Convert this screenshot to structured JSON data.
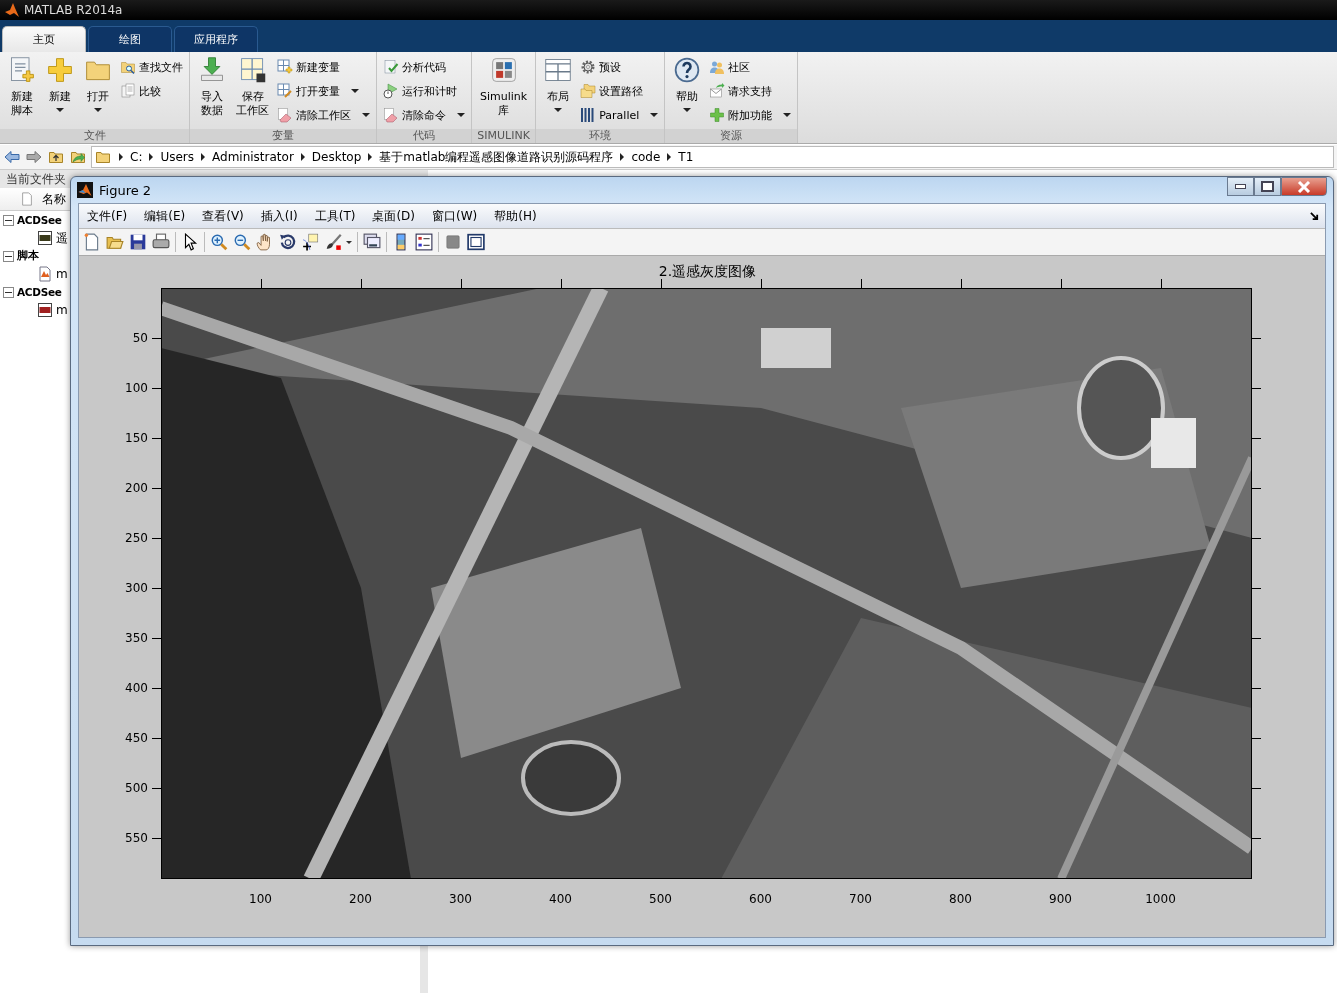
{
  "window": {
    "title": "MATLAB R2014a"
  },
  "tabs": [
    {
      "label": "主页",
      "selected": true
    },
    {
      "label": "绘图",
      "selected": false
    },
    {
      "label": "应用程序",
      "selected": false
    }
  ],
  "ribbon": [
    {
      "label": "文件",
      "large": [
        {
          "lines": [
            "新建",
            "脚本"
          ],
          "dropdown": false
        },
        {
          "lines": [
            "新建"
          ],
          "dropdown": true
        },
        {
          "lines": [
            "打开"
          ],
          "dropdown": true
        }
      ],
      "small": [
        {
          "label": "查找文件",
          "dropdown": false
        },
        {
          "label": "比较",
          "dropdown": false
        }
      ]
    },
    {
      "label": "变量",
      "large": [
        {
          "lines": [
            "导入",
            "数据"
          ],
          "dropdown": false
        },
        {
          "lines": [
            "保存",
            "工作区"
          ],
          "dropdown": false
        }
      ],
      "small": [
        {
          "label": "新建变量",
          "dropdown": false
        },
        {
          "label": "打开变量",
          "dropdown": true
        },
        {
          "label": "清除工作区",
          "dropdown": true
        }
      ]
    },
    {
      "label": "代码",
      "small": [
        {
          "label": "分析代码",
          "dropdown": false
        },
        {
          "label": "运行和计时",
          "dropdown": false
        },
        {
          "label": "清除命令",
          "dropdown": true
        }
      ]
    },
    {
      "label": "SIMULINK",
      "large": [
        {
          "lines": [
            "Simulink",
            "库"
          ],
          "dropdown": false
        }
      ]
    },
    {
      "label": "环境",
      "large": [
        {
          "lines": [
            "布局"
          ],
          "dropdown": true
        }
      ],
      "small": [
        {
          "label": "预设",
          "dropdown": false
        },
        {
          "label": "设置路径",
          "dropdown": false
        },
        {
          "label": "Parallel",
          "dropdown": true
        }
      ]
    },
    {
      "label": "资源",
      "large": [
        {
          "lines": [
            "帮助"
          ],
          "dropdown": true
        }
      ],
      "small": [
        {
          "label": "社区",
          "dropdown": false
        },
        {
          "label": "请求支持",
          "dropdown": false
        },
        {
          "label": "附加功能",
          "dropdown": true
        }
      ]
    }
  ],
  "address_path": [
    "C:",
    "Users",
    "Administrator",
    "Desktop",
    "基于matlab编程遥感图像道路识别源码程序",
    "code",
    "T1"
  ],
  "current_folder": {
    "title": "当前文件夹",
    "column": "名称",
    "tree": [
      {
        "label": "ACDSee",
        "expanded": true,
        "children": [
          {
            "label": "遥"
          }
        ]
      },
      {
        "label": "脚本",
        "expanded": true,
        "children": [
          {
            "label": "m"
          }
        ]
      },
      {
        "label": "ACDSee",
        "expanded": true,
        "children": [
          {
            "label": "m"
          }
        ]
      }
    ]
  },
  "figure": {
    "title": "Figure 2",
    "menu": [
      "文件(F)",
      "编辑(E)",
      "查看(V)",
      "插入(I)",
      "工具(T)",
      "桌面(D)",
      "窗口(W)",
      "帮助(H)"
    ],
    "axes": {
      "title": "2.遥感灰度图像",
      "image": {
        "kind": "picture"
      },
      "x_ticks": [
        "100",
        "200",
        "300",
        "400",
        "500",
        "600",
        "700",
        "800",
        "900",
        "1000"
      ],
      "y_ticks": [
        "50",
        "100",
        "150",
        "200",
        "250",
        "300",
        "350",
        "400",
        "450",
        "500",
        "550"
      ]
    }
  }
}
